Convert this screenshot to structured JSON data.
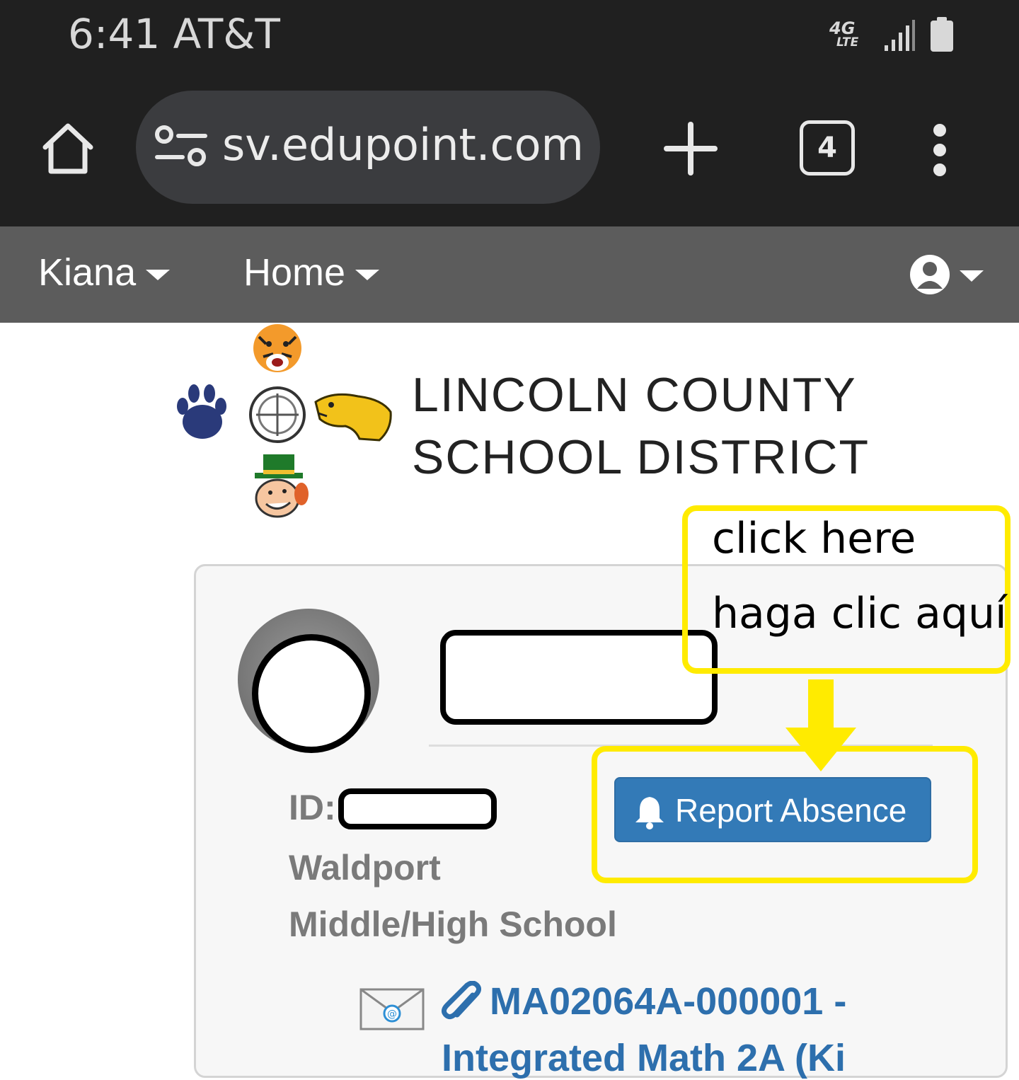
{
  "status_bar": {
    "time_carrier": "6:41 AT&T",
    "network": "4G",
    "network_sub": "LTE",
    "signal_icon": "signal-icon",
    "battery_icon": "battery-icon"
  },
  "browser": {
    "url": "sv.edupoint.com",
    "tab_count": "4",
    "icons": [
      "home-icon",
      "site-settings-icon",
      "plus-icon",
      "tabs-icon",
      "more-vert-icon"
    ]
  },
  "nav": {
    "student": "Kiana",
    "home": "Home",
    "account_icon": "user-circle-icon"
  },
  "district": {
    "line1": "LINCOLN COUNTY",
    "line2": "SCHOOL DISTRICT"
  },
  "student_card": {
    "id_label": "ID:",
    "school_line1": "Waldport",
    "school_line2": "Middle/High School",
    "report_button": "Report Absence",
    "section_link": "MA02064A-000001 -",
    "section_link_2": "Integrated Math 2A (Ki"
  },
  "annotation": {
    "line1": "click here",
    "line2": "haga clic aquí"
  },
  "colors": {
    "status_bg": "#202020",
    "nav_bg": "#5c5c5c",
    "button_blue": "#337ab7",
    "highlight_yellow": "#ffeb00",
    "link_blue": "#2d6fad"
  }
}
